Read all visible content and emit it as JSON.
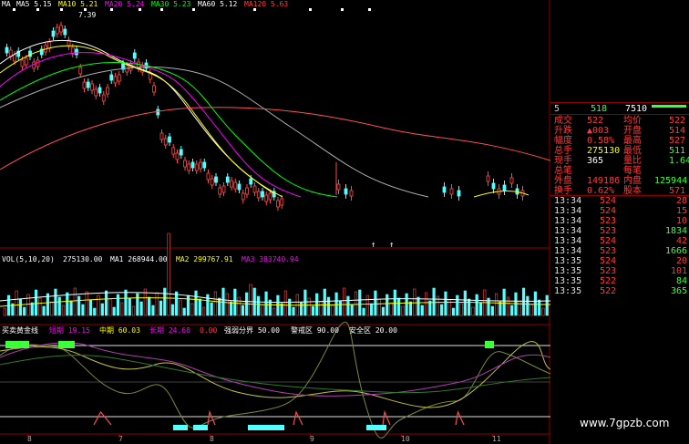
{
  "colors": {
    "up": "#ff4a4a",
    "down": "#54ffff",
    "ma5": "#ffffff",
    "ma10": "#ffff00",
    "ma20": "#ff00ff",
    "ma30": "#00ff00",
    "ma60": "#b0b0b0",
    "ma120": "#ff5050",
    "grid": "#8b0000",
    "label_red": "#ff3b3b",
    "label_green": "#3cff3c",
    "label_yellow": "#ffff00"
  },
  "main_legend": [
    {
      "text": "MA",
      "color": "#ffffff"
    },
    {
      "text": "MA5 5.15",
      "color": "#ffffff"
    },
    {
      "text": "MA10 5.21",
      "color": "#ffff00"
    },
    {
      "text": "MA20 5.24",
      "color": "#ff00ff"
    },
    {
      "text": "MA30 5.23",
      "color": "#00ff00"
    },
    {
      "text": "MA60 5.12",
      "color": "#ffffff"
    },
    {
      "text": "MA120 5.63",
      "color": "#ff3b3b"
    }
  ],
  "price_high_label": "7.39",
  "bottom_markers": [
    "↑",
    "↑"
  ],
  "vol_legend": [
    {
      "text": "VOL(5,10,20)",
      "color": "#ffffff"
    },
    {
      "text": "275130.00",
      "color": "#ffffff"
    },
    {
      "text": "MA1 268944.00",
      "color": "#ffffff"
    },
    {
      "text": "MA2 299767.91",
      "color": "#ffff00"
    },
    {
      "text": "MA3 383740.94",
      "color": "#ff00ff"
    }
  ],
  "ind_legend": [
    {
      "text": "买卖黄金线",
      "color": "#ffffff"
    },
    {
      "text": "短期 19.15",
      "color": "#ff00ff"
    },
    {
      "text": "中期 60.03",
      "color": "#ffff00"
    },
    {
      "text": "长期 24.68",
      "color": "#ff00ff"
    },
    {
      "text": "0.00",
      "color": "#ff3b3b"
    },
    {
      "text": "强弱分界 50.00",
      "color": "#ffffff"
    },
    {
      "text": "警戒区 90.00",
      "color": "#ffffff"
    },
    {
      "text": "安全区 20.00",
      "color": "#ffffff"
    }
  ],
  "x_ticks": [
    "8",
    "7",
    "8",
    "9",
    "10",
    "11"
  ],
  "quote": {
    "header_left": "5",
    "header_mid": "518",
    "header_right": "7510",
    "rows": [
      {
        "l": "成交",
        "lv": "522",
        "r": "均价",
        "rv": "522"
      },
      {
        "l": "升跌",
        "lv": "▲003",
        "r": "开盘",
        "rv": "514"
      },
      {
        "l": "幅度",
        "lv": "0.58%",
        "r": "最高",
        "rv": "527"
      },
      {
        "l": "总手",
        "lv": "275130",
        "r": "最低",
        "rv": "511"
      },
      {
        "l": "现手",
        "lv": "365",
        "r": "量比",
        "rv": "1.64"
      },
      {
        "l": "总笔",
        "lv": "",
        "r": "每笔",
        "rv": ""
      },
      {
        "l": "外盘",
        "lv": "149186",
        "r": "内盘",
        "rv": "125944"
      },
      {
        "l": "换手",
        "lv": "0.62%",
        "r": "股本",
        "rv": "571"
      }
    ]
  },
  "ticks": [
    {
      "time": "13:34",
      "price": "524",
      "vol": "28"
    },
    {
      "time": "13:34",
      "price": "524",
      "vol": "15"
    },
    {
      "time": "13:34",
      "price": "523",
      "vol": "10"
    },
    {
      "time": "13:34",
      "price": "523",
      "vol": "1834"
    },
    {
      "time": "13:34",
      "price": "524",
      "vol": "42"
    },
    {
      "time": "13:34",
      "price": "523",
      "vol": "1666"
    },
    {
      "time": "13:35",
      "price": "524",
      "vol": "20"
    },
    {
      "time": "13:35",
      "price": "523",
      "vol": "101"
    },
    {
      "time": "13:35",
      "price": "522",
      "vol": "84"
    },
    {
      "time": "13:35",
      "price": "522",
      "vol": "365"
    }
  ],
  "watermark": "www.7gpzb.com"
}
